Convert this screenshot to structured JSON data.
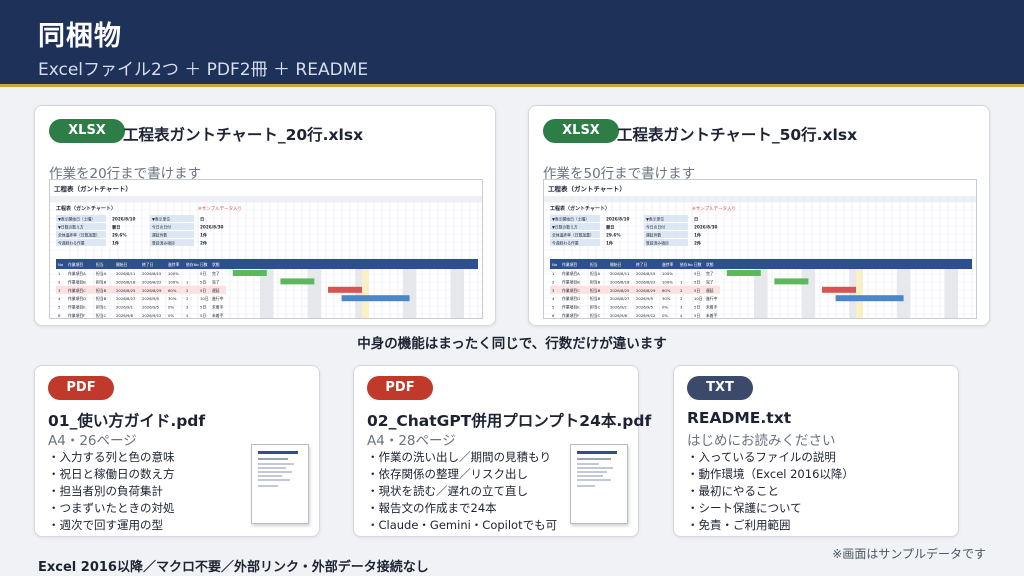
{
  "header": {
    "title": "同梱物",
    "subtitle": "Excelファイル2つ ＋ PDF2冊 ＋ README"
  },
  "xlsx_cards": [
    {
      "badge": "XLSX",
      "title": "工程表ガントチャート_20行.xlsx",
      "subtitle": "作業を20行まで書けます",
      "sheet": {
        "sheet_title": "工程表（ガントチャート）",
        "sample_note": "※サンプルデータ入り",
        "info": [
          [
            "▼表示開始日（土曜）",
            "2026/8/10",
            "▼表示単位",
            "日"
          ],
          [
            "▼日数の数え方",
            "暦日",
            "今日の日付",
            "2026/8/30"
          ],
          [
            "全体進捗率（日数加重）",
            "29.6%",
            "遅延件数",
            "1件"
          ],
          [
            "今週終わる作業",
            "1件",
            "登録済み項目",
            "2件"
          ]
        ],
        "table_headers": [
          "No",
          "作業項目",
          "担当",
          "開始日",
          "終了日",
          "進捗率",
          "依存No",
          "日数",
          "状態"
        ],
        "rows": [
          [
            "1",
            "作業項目A",
            "担当A",
            "2026/8/11",
            "2026/8/15",
            "100%",
            "",
            "5日",
            "完了"
          ],
          [
            "2",
            "作業項目B",
            "担当B",
            "2026/8/18",
            "2026/8/22",
            "100%",
            "1",
            "5日",
            "完了"
          ],
          [
            "3",
            "作業項目C",
            "担当B",
            "2026/8/25",
            "2026/8/29",
            "60%",
            "2",
            "5日",
            "遅延"
          ],
          [
            "4",
            "作業項目D",
            "担当B",
            "2026/8/27",
            "2026/9/5",
            "30%",
            "2",
            "10日",
            "進行中"
          ],
          [
            "5",
            "作業項目E",
            "担当C",
            "2026/9/1",
            "2026/9/5",
            "0%",
            "3",
            "5日",
            "未着手"
          ],
          [
            "6",
            "作業項目F",
            "担当C",
            "2026/9/8",
            "2026/9/12",
            "0%",
            "4",
            "5日",
            "未着手"
          ]
        ]
      }
    },
    {
      "badge": "XLSX",
      "title": "工程表ガントチャート_50行.xlsx",
      "subtitle": "作業を50行まで書けます",
      "sheet": {
        "sheet_title": "工程表（ガントチャート）",
        "sample_note": "※サンプルデータ入り",
        "info": [
          [
            "▼表示開始日（土曜）",
            "2026/8/10",
            "▼表示単位",
            "日"
          ],
          [
            "▼日数の数え方",
            "暦日",
            "今日の日付",
            "2026/8/30"
          ],
          [
            "全体進捗率（日数加重）",
            "29.6%",
            "遅延件数",
            "1件"
          ],
          [
            "今週終わる作業",
            "1件",
            "登録済み項目",
            "2件"
          ]
        ],
        "table_headers": [
          "No",
          "作業項目",
          "担当",
          "開始日",
          "終了日",
          "進捗率",
          "依存No",
          "日数",
          "状態"
        ],
        "rows": [
          [
            "1",
            "作業項目A",
            "担当A",
            "2026/8/11",
            "2026/8/15",
            "100%",
            "",
            "5日",
            "完了"
          ],
          [
            "2",
            "作業項目B",
            "担当B",
            "2026/8/18",
            "2026/8/22",
            "100%",
            "1",
            "5日",
            "完了"
          ],
          [
            "3",
            "作業項目C",
            "担当B",
            "2026/8/25",
            "2026/8/29",
            "60%",
            "2",
            "5日",
            "遅延"
          ],
          [
            "4",
            "作業項目D",
            "担当B",
            "2026/8/27",
            "2026/9/5",
            "30%",
            "2",
            "10日",
            "進行中"
          ],
          [
            "5",
            "作業項目E",
            "担当C",
            "2026/9/1",
            "2026/9/5",
            "0%",
            "3",
            "5日",
            "未着手"
          ],
          [
            "6",
            "作業項目F",
            "担当C",
            "2026/9/8",
            "2026/9/12",
            "0%",
            "4",
            "5日",
            "未着手"
          ]
        ]
      }
    }
  ],
  "caption": "中身の機能はまったく同じで、行数だけが違います",
  "doc_cards": [
    {
      "badge": "PDF",
      "title": "01_使い方ガイド.pdf",
      "subtitle": "A4・26ページ",
      "bullets": [
        "・入力する列と色の意味",
        "・祝日と稼働日の数え方",
        "・担当者別の負荷集計",
        "・つまずいたときの対処",
        "・週次で回す運用の型"
      ]
    },
    {
      "badge": "PDF",
      "title": "02_ChatGPT併用プロンプト24本.pdf",
      "subtitle": "A4・28ページ",
      "bullets": [
        "・作業の洗い出し／期間の見積もり",
        "・依存関係の整理／リスク出し",
        "・現状を読む／遅れの立て直し",
        "・報告文の作成まで24本",
        "・Claude・Gemini・Copilotでも可"
      ]
    },
    {
      "badge": "TXT",
      "title": "README.txt",
      "subtitle": "はじめにお読みください",
      "bullets": [
        "・入っているファイルの説明",
        "・動作環境（Excel 2016以降）",
        "・最初にやること",
        "・シート保護について",
        "・免責・ご利用範囲"
      ]
    }
  ],
  "footer": {
    "left": "Excel 2016以降／マクロ不要／外部リンク・外部データ接続なし",
    "right": "※画面はサンプルデータです"
  },
  "colors": {
    "header_bg": "#1e3158",
    "accent_gold": "#c9a63b",
    "xlsx_badge": "#2e7d47",
    "pdf_badge": "#c0392b",
    "txt_badge": "#3b4a6b",
    "table_header": "#2e4f8f",
    "bar_done": "#5cb85c",
    "bar_late": "#d9534f",
    "bar_progress": "#4a86c8"
  }
}
